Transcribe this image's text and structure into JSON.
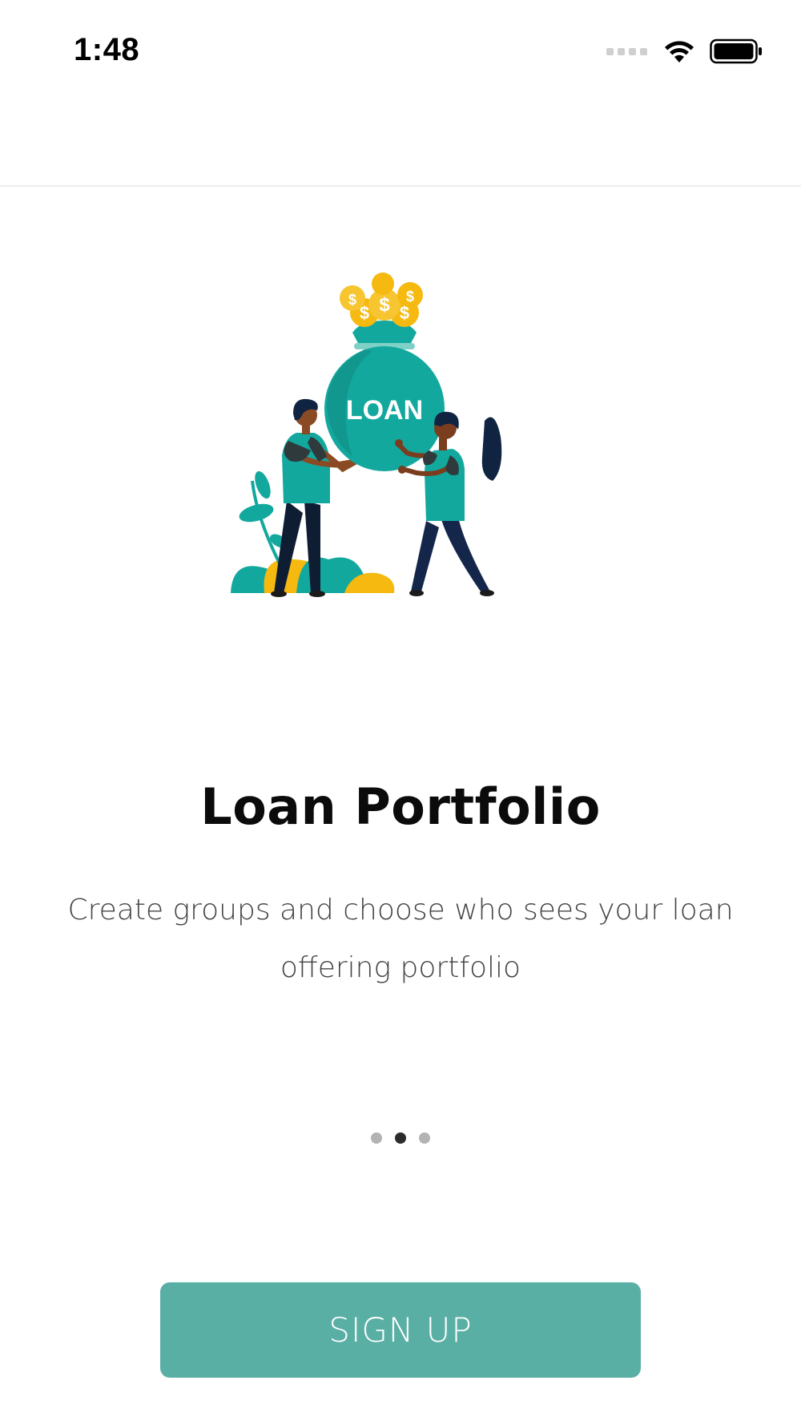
{
  "status_bar": {
    "time": "1:48",
    "icons": [
      "signal-dots-icon",
      "wifi-icon",
      "battery-icon"
    ]
  },
  "illustration": {
    "icon": "loan-bag-illustration",
    "bag_label": "LOAN",
    "coin_symbol": "$"
  },
  "onboarding": {
    "title": "Loan Portfolio",
    "description": "Create groups and choose who sees your loan offering portfolio",
    "page_indicator": {
      "total": 3,
      "active": 2
    }
  },
  "actions": {
    "signup_label": "SIGN UP"
  },
  "colors": {
    "accent": "#5aafa5",
    "teal": "#13a89e",
    "gold": "#f5b90f",
    "navy": "#14274a"
  }
}
